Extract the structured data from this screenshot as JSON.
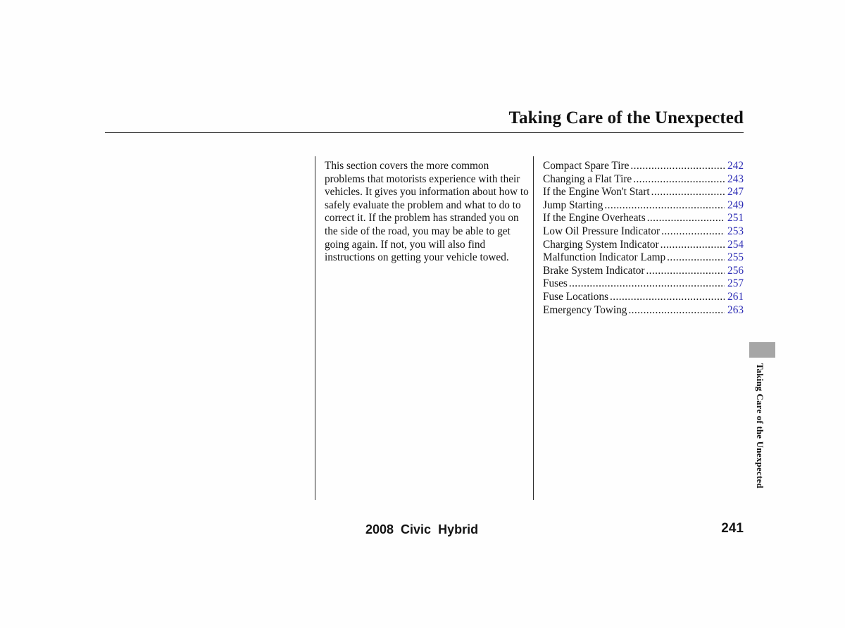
{
  "header": {
    "section_title": "Taking Care of the Unexpected"
  },
  "intro": {
    "text": "This section covers the more common problems that motorists experience with their vehicles. It gives you information about how to safely evaluate the problem and what to do to correct it. If the problem has stranded you on the side of the road, you may be able to get going again. If not, you will also find instructions on getting your vehicle towed."
  },
  "toc": {
    "leader": "................................................................",
    "entries": [
      {
        "label": "Compact Spare Tire",
        "page": "242"
      },
      {
        "label": "Changing a Flat Tire",
        "page": "243"
      },
      {
        "label": "If the Engine Won't Start",
        "page": "247"
      },
      {
        "label": "Jump Starting",
        "page": "249"
      },
      {
        "label": "If the Engine Overheats",
        "page": "251"
      },
      {
        "label": "Low Oil Pressure Indicator",
        "page": "253"
      },
      {
        "label": "Charging System Indicator",
        "page": "254"
      },
      {
        "label": "Malfunction Indicator Lamp",
        "page": "255"
      },
      {
        "label": "Brake System Indicator",
        "page": "256"
      },
      {
        "label": "Fuses",
        "page": "257"
      },
      {
        "label": "Fuse Locations",
        "page": "261"
      },
      {
        "label": "Emergency Towing",
        "page": "263"
      }
    ]
  },
  "side_tab": {
    "label": "Taking Care of the Unexpected"
  },
  "footer": {
    "model": "2008  Civic  Hybrid",
    "page_number": "241"
  },
  "colors": {
    "page_number_blue": "#2d2db5",
    "side_tab_gray": "#a6a6a6",
    "text_black": "#131313"
  }
}
